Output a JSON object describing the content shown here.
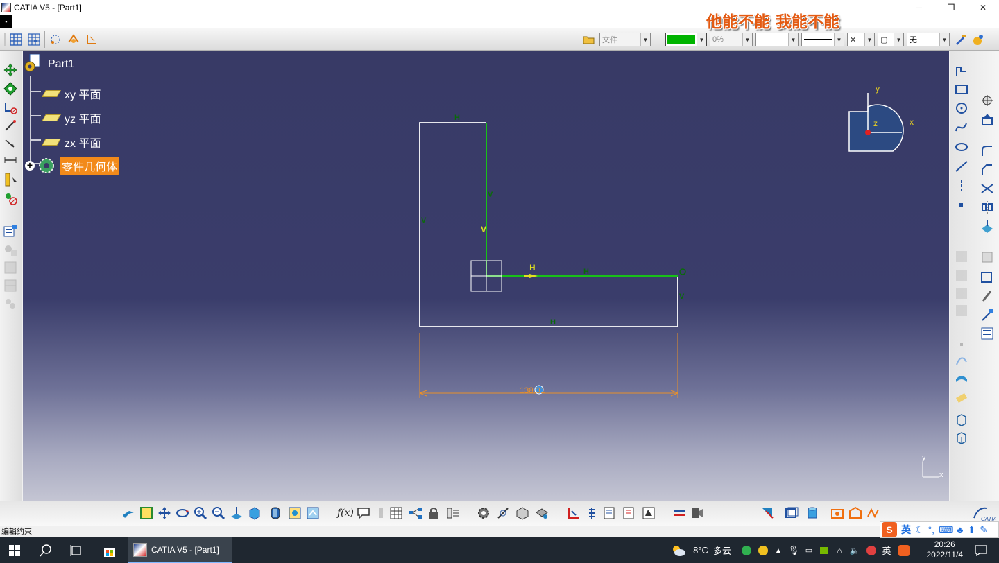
{
  "window": {
    "title": "CATIA V5 - [Part1]",
    "minimize_glyph": "─",
    "restore_glyph": "❐",
    "close_glyph": "✕"
  },
  "overlay_caption": "他能不能 我能不能",
  "toolbar_top": {
    "file_combo": "文件",
    "color_swatch": "#00b400",
    "transparency_combo": "0%",
    "layer_combo": "无"
  },
  "tree": {
    "root": "Part1",
    "items": [
      {
        "label": "xy 平面"
      },
      {
        "label": "yz 平面"
      },
      {
        "label": "zx 平面"
      },
      {
        "label": "零件几何体"
      }
    ],
    "expand_glyph": "+"
  },
  "sketch": {
    "constraint_h": "H",
    "constraint_v": "V",
    "dimension": "138.31",
    "colors": {
      "profile": "#ffffff",
      "active_line": "#18c018",
      "dimension": "#e8902a",
      "constraint_label": "#0a6a0a"
    }
  },
  "compass": {
    "x": "x",
    "y": "y",
    "z": "z"
  },
  "axis_triad": {
    "x": "x",
    "y": "y"
  },
  "statusbar": {
    "message": "编辑约束"
  },
  "taskbar": {
    "app_label": "CATIA V5 - [Part1]",
    "weather": "8°C",
    "weather_desc": "多云",
    "ime": "英",
    "time": "20:26",
    "date": "2022/11/4"
  },
  "imebar": {
    "logo": "S",
    "mode": "英"
  },
  "icons": {
    "brand": "catia-logo"
  }
}
